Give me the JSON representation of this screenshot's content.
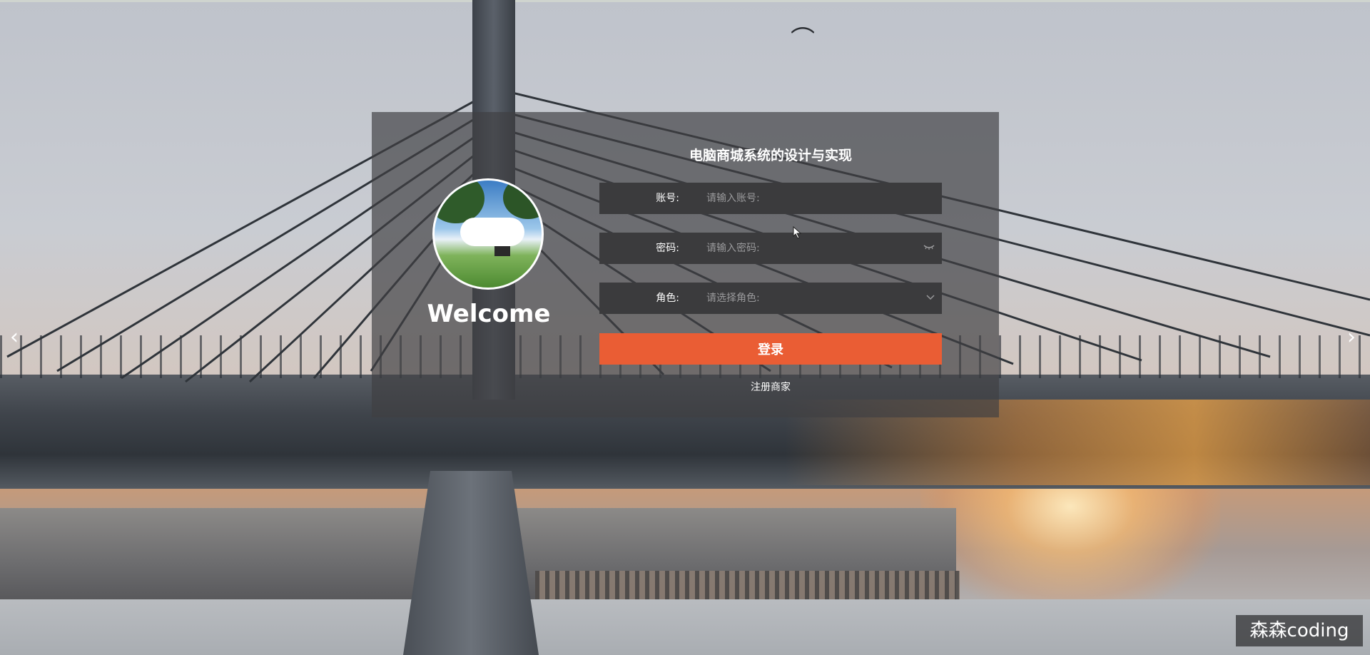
{
  "login": {
    "title": "电脑商城系统的设计与实现",
    "welcome": "Welcome",
    "fields": [
      {
        "label": "账号:",
        "placeholder": "请输入账号:"
      },
      {
        "label": "密码:",
        "placeholder": "请输入密码:"
      },
      {
        "label": "角色:",
        "placeholder": "请选择角色:"
      }
    ],
    "login_button": "登录",
    "register_link": "注册商家"
  },
  "carousel": {
    "prev_icon": "‹",
    "next_icon": "›"
  },
  "icons": {
    "password_toggle": "eye-closed-icon",
    "role_dropdown": "chevron-down-icon"
  },
  "watermark": "森森coding",
  "colors": {
    "panel_bg": "#404042",
    "field_bg": "#3b3b3d",
    "login_button": "#ea5d34"
  }
}
